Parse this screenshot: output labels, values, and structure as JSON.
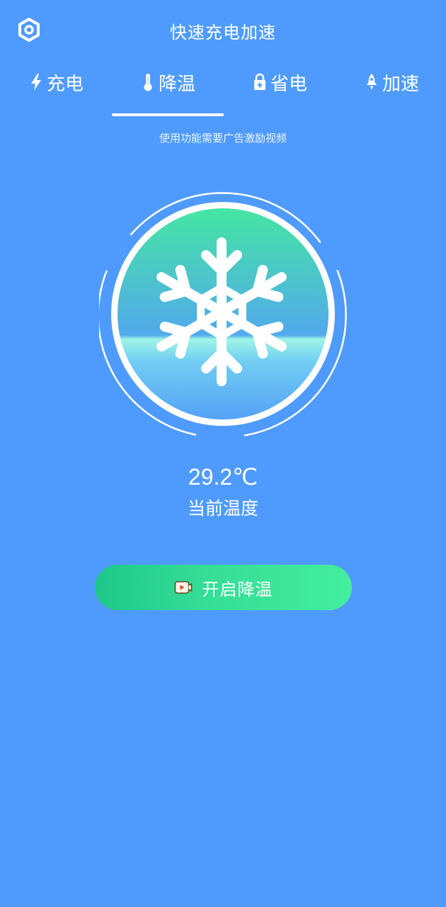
{
  "header": {
    "title": "快速充电加速",
    "settings_icon": "hexagon-settings-icon"
  },
  "tabs": [
    {
      "label": "充电",
      "icon": "lightning-icon",
      "active": false
    },
    {
      "label": "降温",
      "icon": "thermometer-icon",
      "active": true
    },
    {
      "label": "省电",
      "icon": "battery-lock-icon",
      "active": false
    },
    {
      "label": "加速",
      "icon": "rocket-icon",
      "active": false
    }
  ],
  "notice": "使用功能需要广告激励视频",
  "status": {
    "temperature": "29.2℃",
    "temperature_label": "当前温度"
  },
  "action": {
    "label": "开启降温",
    "icon": "video-play-icon"
  },
  "colors": {
    "background": "#4f9bfd",
    "circle_top": "#45e6a2",
    "circle_bottom": "#56a6f5",
    "button_start": "#1ec78a",
    "button_end": "#44ee9e"
  }
}
